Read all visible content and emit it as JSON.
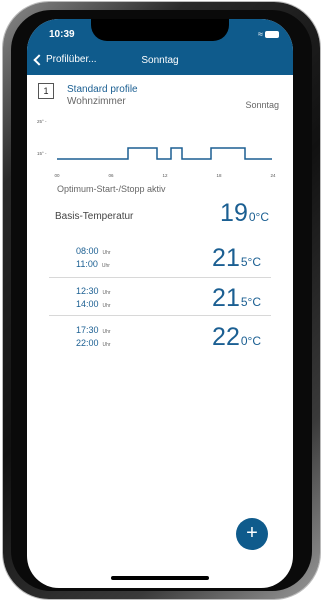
{
  "status": {
    "time": "10:39",
    "signal_icon": "wifi-icon",
    "battery_icon": "battery-icon"
  },
  "nav": {
    "back_label": "Profilüber...",
    "title": "Sonntag"
  },
  "profile": {
    "number": "1",
    "name": "Standard profile",
    "room": "Wohnzimmer",
    "day": "Sonntag"
  },
  "graph": {
    "y_labels": [
      "25° -",
      "15° -"
    ],
    "x_labels": [
      "00",
      "06",
      "12",
      "18",
      "24"
    ]
  },
  "optimum": "Optimum-Start-/Stopp aktiv",
  "basis": {
    "label": "Basis-Temperatur",
    "value": "19",
    "unit": "0°C"
  },
  "schedule": [
    {
      "start": "08:00",
      "end": "11:00",
      "uhr": "Uhr",
      "value": "21",
      "unit": "5°C"
    },
    {
      "start": "12:30",
      "end": "14:00",
      "uhr": "Uhr",
      "value": "21",
      "unit": "5°C"
    },
    {
      "start": "17:30",
      "end": "22:00",
      "uhr": "Uhr",
      "value": "22",
      "unit": "0°C"
    }
  ],
  "fab": {
    "label": "+"
  },
  "colors": {
    "primary": "#0f5b8c",
    "text_blue": "#1b5f92",
    "line": "#1b5f92"
  }
}
